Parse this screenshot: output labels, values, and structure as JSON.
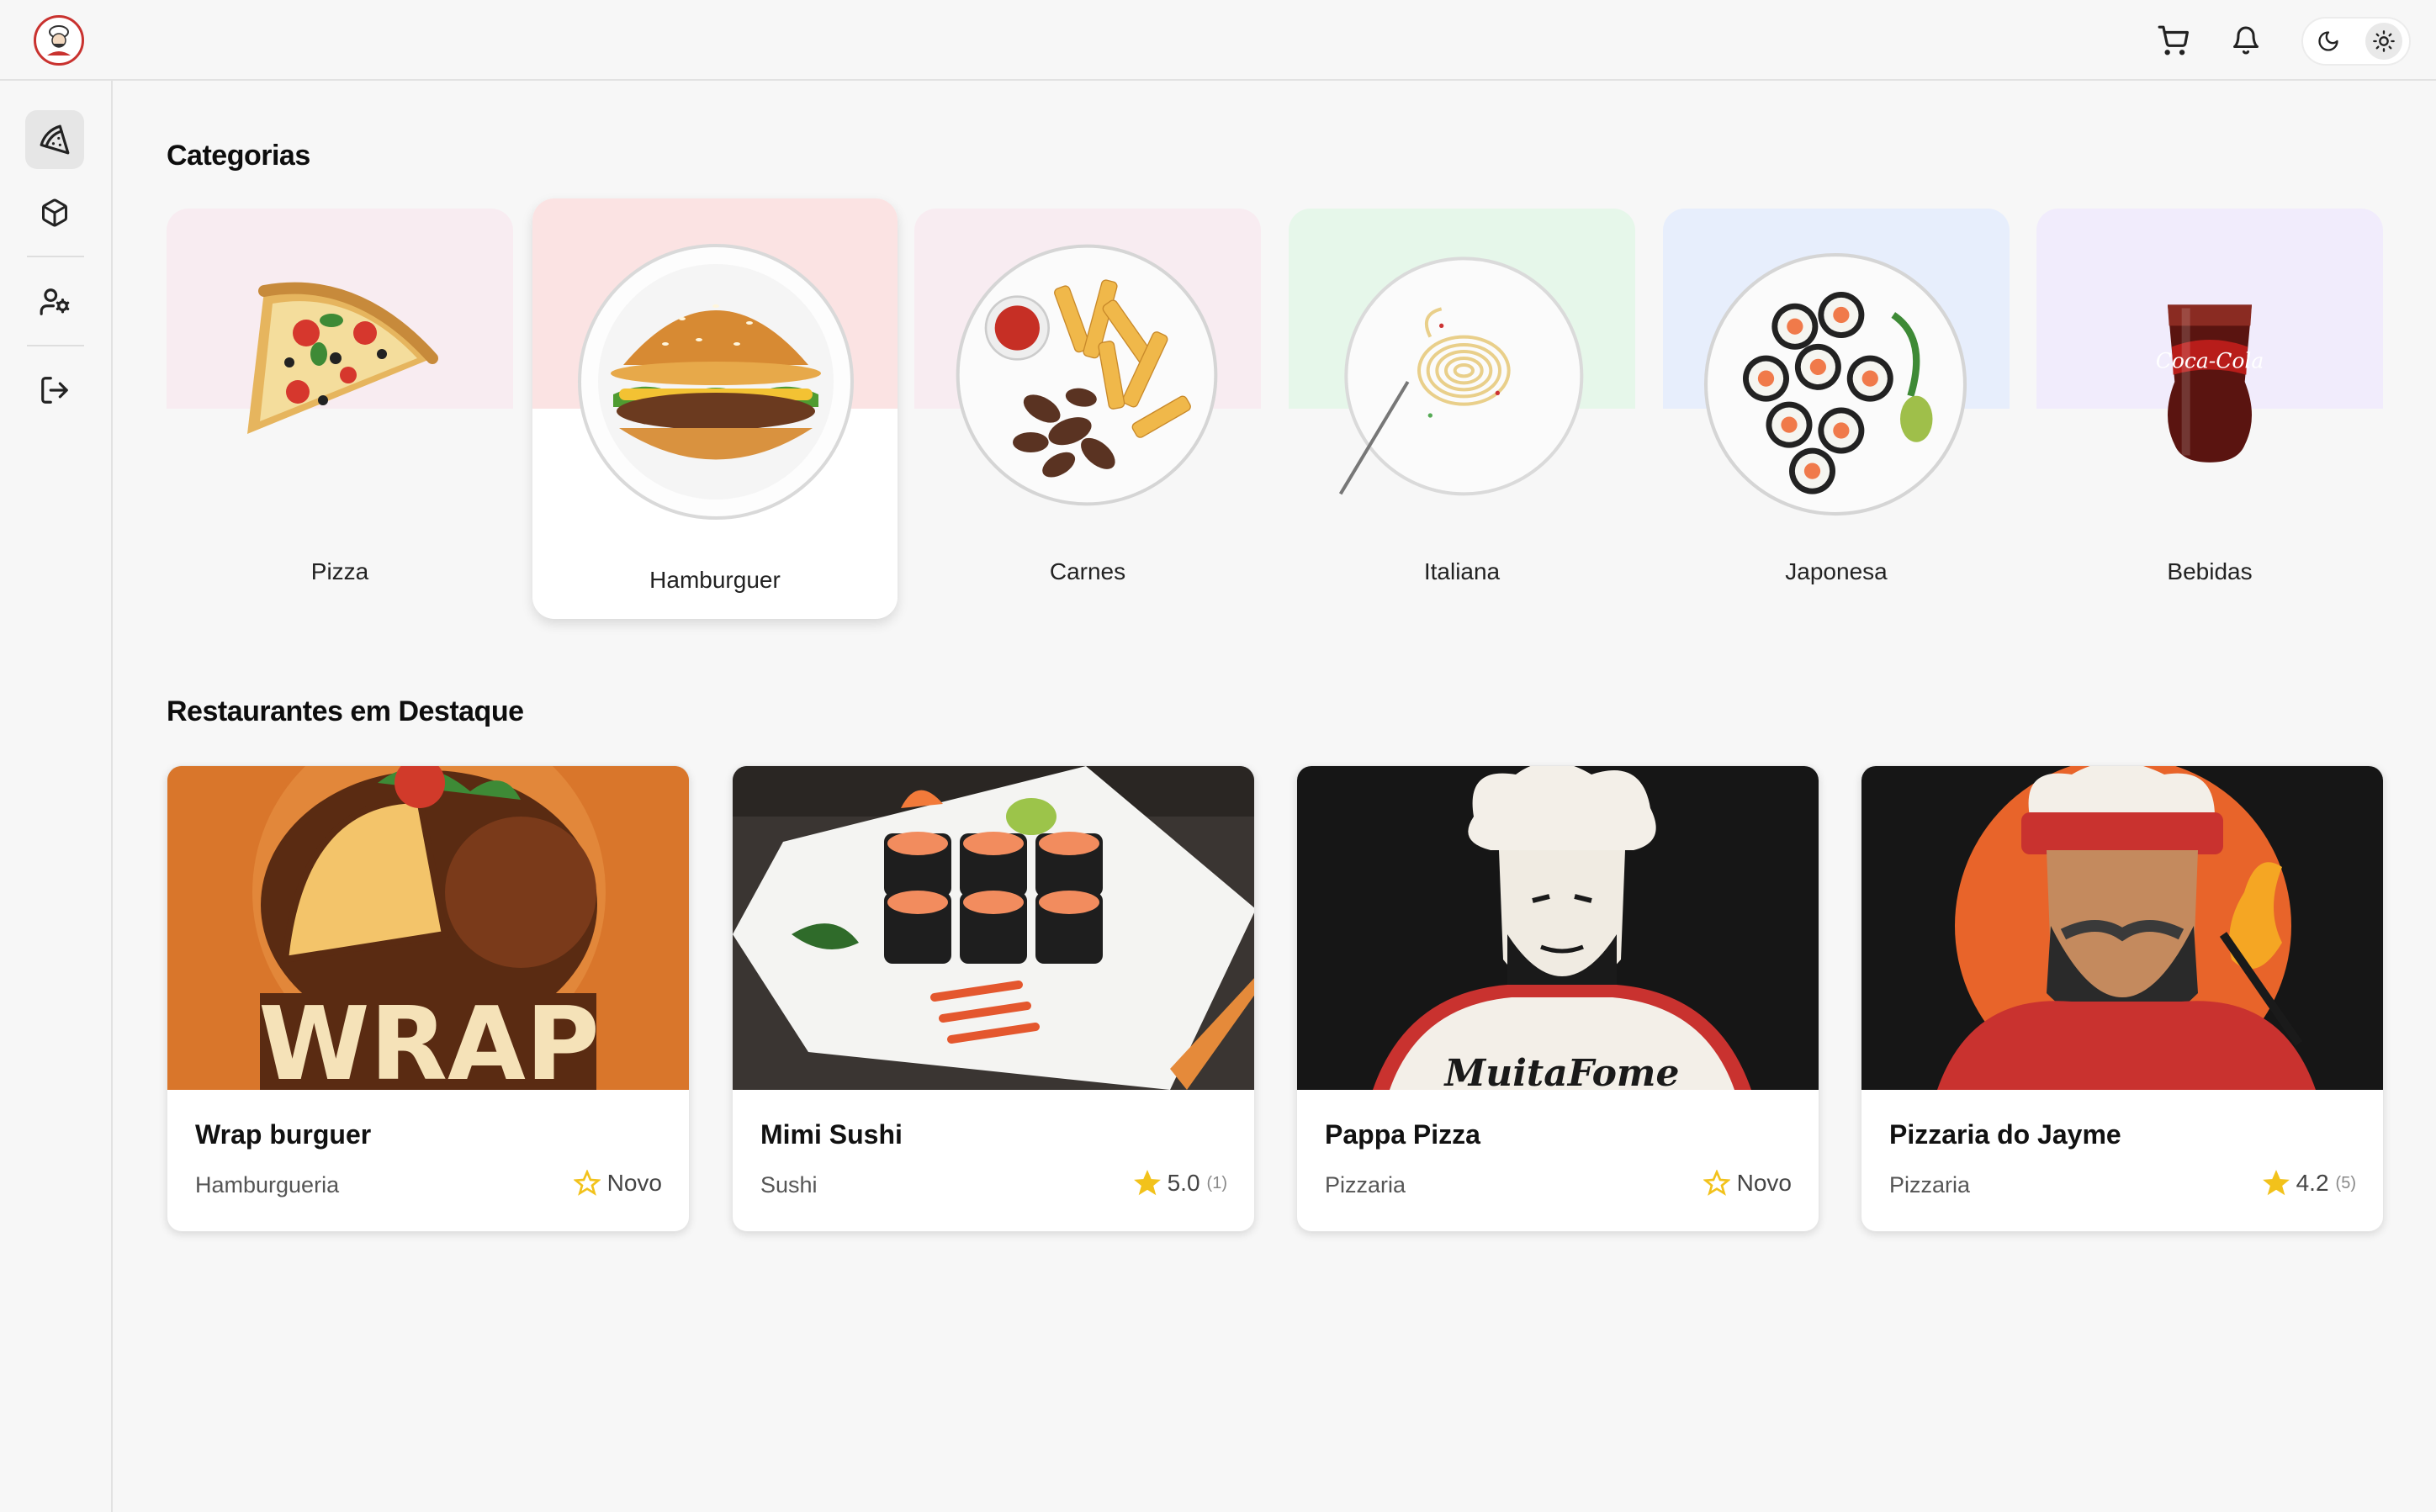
{
  "app": {
    "logo_text": "MuitaFome"
  },
  "header": {
    "cart_icon": "cart-icon",
    "bell_icon": "bell-icon",
    "theme": {
      "dark_icon": "moon-icon",
      "light_icon": "sun-icon",
      "selected": "light"
    }
  },
  "sidebar": {
    "items": [
      {
        "icon": "pizza-slice-icon",
        "active": true
      },
      {
        "icon": "box-icon",
        "active": false
      },
      {
        "icon": "user-settings-icon",
        "active": false
      },
      {
        "icon": "logout-icon",
        "active": false
      }
    ]
  },
  "categories": {
    "title": "Categorias",
    "items": [
      {
        "label": "Pizza",
        "bg": "#f8ecf1",
        "active": false
      },
      {
        "label": "Hamburguer",
        "bg": "#fbe3e3",
        "active": true
      },
      {
        "label": "Carnes",
        "bg": "#f8ecf1",
        "active": false
      },
      {
        "label": "Italiana",
        "bg": "#e6f7ea",
        "active": false
      },
      {
        "label": "Japonesa",
        "bg": "#e7eefc",
        "active": false
      },
      {
        "label": "Bebidas",
        "bg": "#f1ecfc",
        "active": false
      }
    ]
  },
  "featured": {
    "title": "Restaurantes em Destaque",
    "restaurants": [
      {
        "name": "Wrap burguer",
        "type": "Hamburgueria",
        "rating": "Novo",
        "count": "",
        "banner_text": "WRAP"
      },
      {
        "name": "Mimi Sushi",
        "type": "Sushi",
        "rating": "5.0",
        "count": "(1)"
      },
      {
        "name": "Pappa Pizza",
        "type": "Pizzaria",
        "rating": "Novo",
        "count": "",
        "banner_text": "MuitaFome"
      },
      {
        "name": "Pizzaria do Jayme",
        "type": "Pizzaria",
        "rating": "4.2",
        "count": "(5)"
      }
    ]
  },
  "colors": {
    "accent_star": "#f2c21b",
    "brand_red": "#c9322f"
  }
}
